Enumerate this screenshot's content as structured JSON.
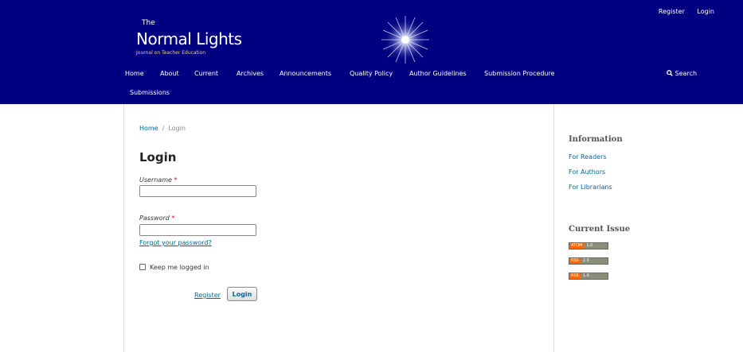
{
  "header": {
    "top_links": [
      "Register",
      "Login"
    ],
    "logo": {
      "the": "The",
      "name": "Normal Lights",
      "tagline": "Journal on Teacher Education"
    },
    "nav": [
      "Home",
      "About",
      "Current",
      "Archives",
      "Announcements",
      "Quality Policy",
      "Author Guidelines",
      "Submission Procedure"
    ],
    "nav_row2": "Submissions",
    "search_label": "Search"
  },
  "breadcrumb": {
    "home": "Home",
    "separator": "/",
    "current": "Login"
  },
  "login": {
    "title": "Login",
    "username_label": "Username",
    "password_label": "Password",
    "required_mark": "*",
    "forgot": "Forgot your password?",
    "keep_logged_in": "Keep me logged in",
    "register": "Register",
    "submit": "Login"
  },
  "sidebar": {
    "info_title": "Information",
    "info_links": [
      "For Readers",
      "For Authors",
      "For Librarians"
    ],
    "issue_title": "Current Issue",
    "feeds": [
      {
        "label": "ATOM",
        "version": "1.0"
      },
      {
        "label": "RSS",
        "version": "2.0"
      },
      {
        "label": "RSS",
        "version": "1.0"
      }
    ]
  },
  "colors": {
    "header_bg": "#000080",
    "link": "#006798",
    "feed_orange": "#ff6600"
  }
}
